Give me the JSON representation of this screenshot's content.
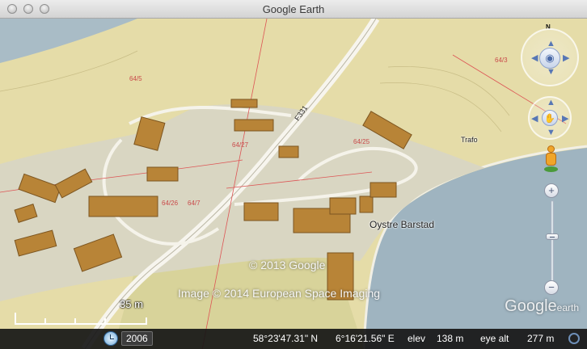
{
  "window": {
    "title": "Google Earth"
  },
  "map": {
    "road_label": "F331",
    "place_label": "Oystre Barstad",
    "water_label": "Trafo",
    "parcel_labels": [
      "64/5",
      "64/26",
      "64/7",
      "64/27",
      "64/25",
      "64/3"
    ],
    "copyright": "© 2013 Google",
    "imagery_credit": "Image © 2014 European Space Imaging",
    "watermark_main": "Google",
    "watermark_sub": "earth"
  },
  "navigation": {
    "north_label": "N",
    "zoom_in_label": "+",
    "zoom_out_label": "−"
  },
  "scale": {
    "label": "35 m"
  },
  "status": {
    "year": "2006",
    "latitude": "58°23'47.31\" N",
    "longitude": "6°16'21.56\" E",
    "elev_label": "elev",
    "elev_value": "138 m",
    "eye_alt_label": "eye alt",
    "eye_alt_value": "277 m"
  }
}
